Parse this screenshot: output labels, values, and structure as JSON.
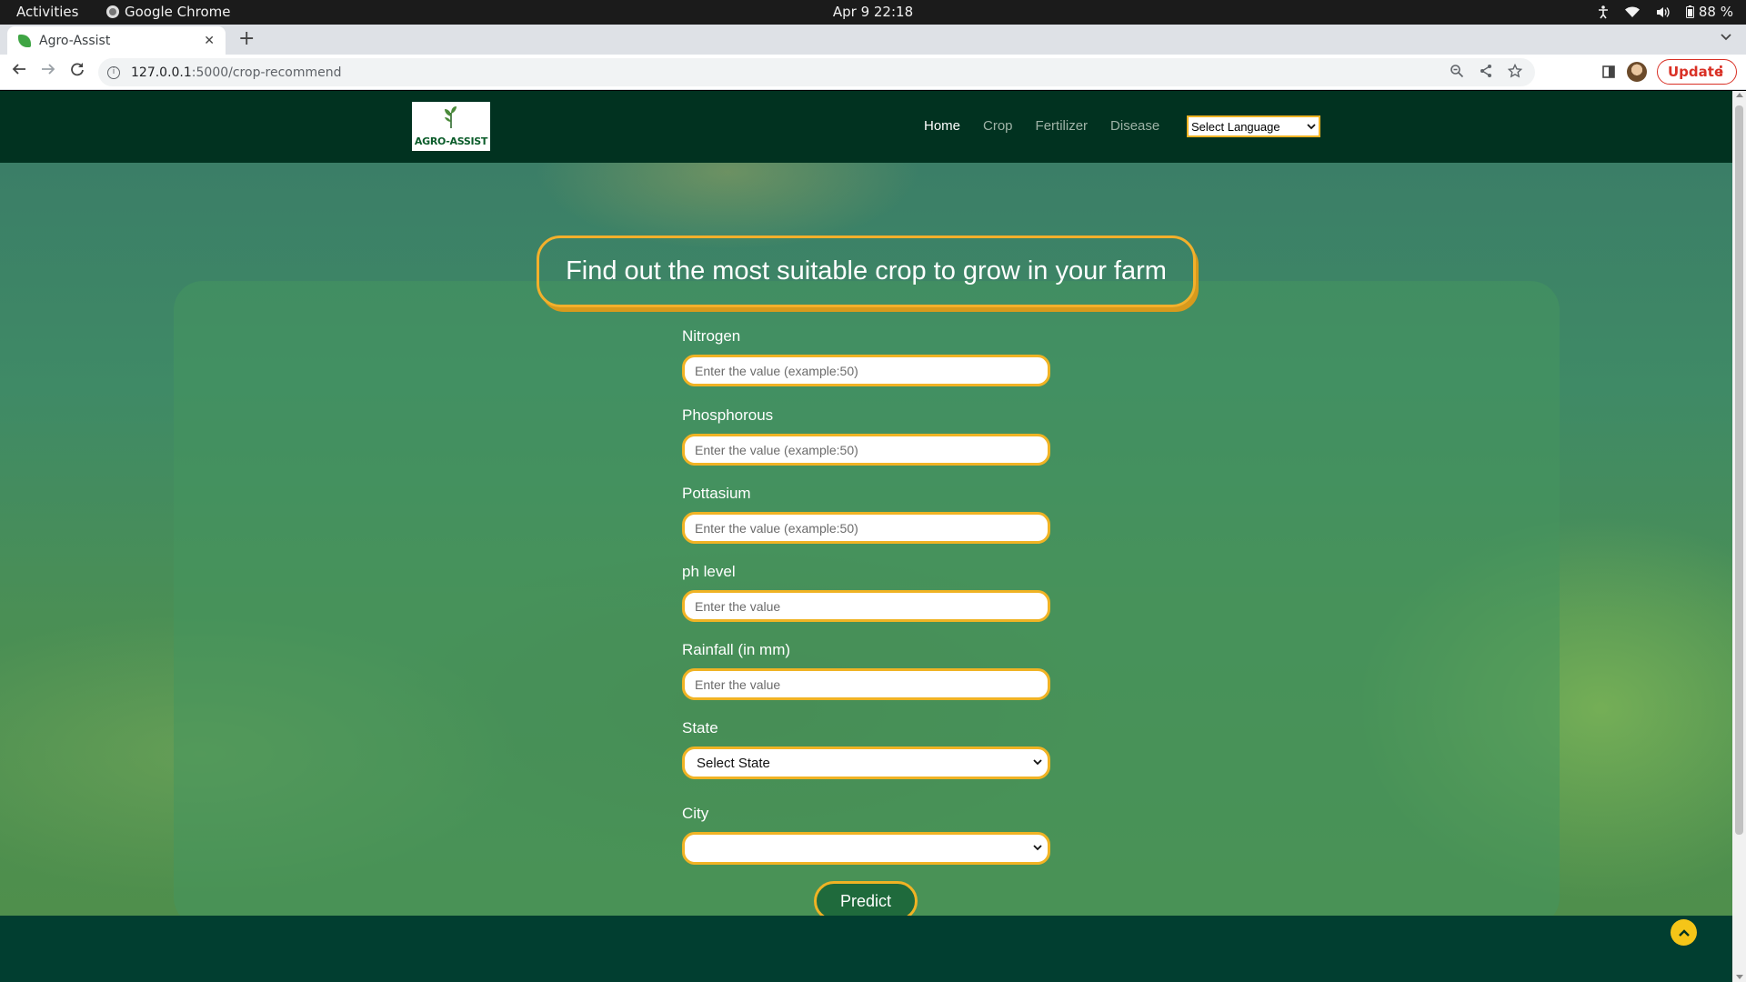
{
  "system_bar": {
    "activities": "Activities",
    "app_name": "Google Chrome",
    "clock": "Apr 9  22:18",
    "battery": "88 %"
  },
  "browser": {
    "tab_title": "Agro-Assist",
    "url_host": "127.0.0.1",
    "url_path": ":5000/crop-recommend",
    "update_label": "Update"
  },
  "site": {
    "logo_text": "AGRO-ASSIST",
    "nav": [
      "Home",
      "Crop",
      "Fertilizer",
      "Disease"
    ],
    "active_nav": "Home",
    "language_select": "Select Language"
  },
  "form": {
    "heading": "Find out the most suitable crop to grow in your farm",
    "fields": [
      {
        "label": "Nitrogen",
        "placeholder": "Enter the value (example:50)"
      },
      {
        "label": "Phosphorous",
        "placeholder": "Enter the value (example:50)"
      },
      {
        "label": "Pottasium",
        "placeholder": "Enter the value (example:50)"
      },
      {
        "label": "ph level",
        "placeholder": "Enter the value"
      },
      {
        "label": "Rainfall (in mm)",
        "placeholder": "Enter the value"
      }
    ],
    "state": {
      "label": "State",
      "selected": "Select State"
    },
    "city": {
      "label": "City",
      "selected": ""
    },
    "submit_label": "Predict"
  },
  "colors": {
    "nav_bg": "#013220",
    "accent_gold": "#f0b324",
    "footer_bg": "#013e30",
    "update_red": "#d93025"
  }
}
